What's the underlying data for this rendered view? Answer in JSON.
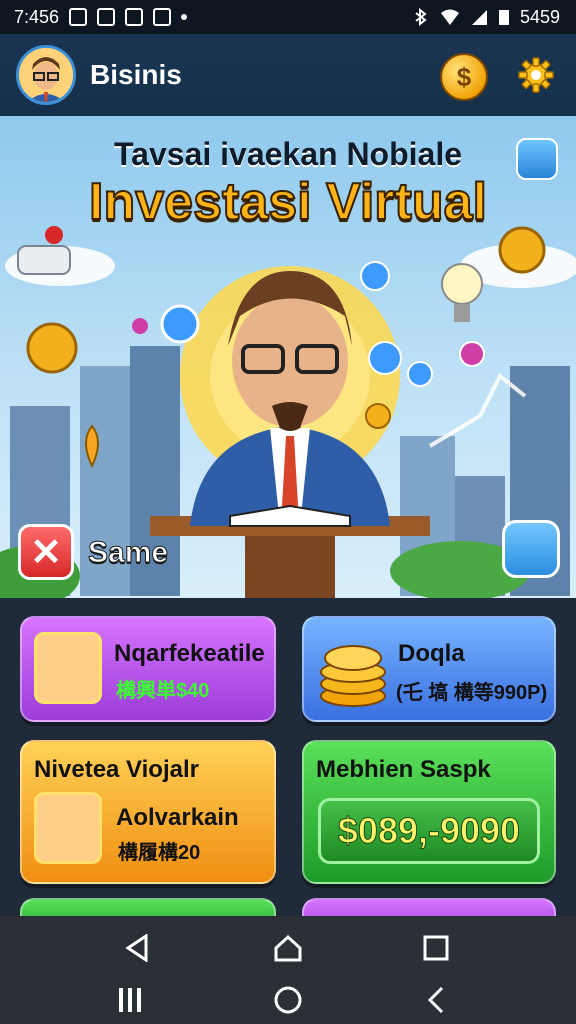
{
  "status_bar": {
    "time": "7:456",
    "right_text": "5459"
  },
  "header": {
    "title": "Bisinis"
  },
  "hero": {
    "subtitle": "Tavsai ivaekan Nobiale",
    "title": "Investasi Virtual",
    "label": "Same",
    "coin_symbol": "$"
  },
  "cards": [
    {
      "title": "Nqarfekeatile",
      "subtitle": "構興単$40",
      "subtitle_color": "#3bff2f"
    },
    {
      "title": "Doqla",
      "subtitle": "(乇 塙 構等990P)",
      "subtitle_color": "#111111"
    },
    {
      "title": "Nivetea Viojalr",
      "name": "Aolvarkain",
      "subtitle": "構履構20",
      "subtitle_color": "#111111"
    },
    {
      "title": "Mebhien Saspk",
      "amount": "$089,-9090"
    }
  ],
  "icons": {
    "header": [
      "avatar",
      "coin-icon",
      "gear-icon"
    ],
    "nav": [
      "back-icon",
      "home-icon",
      "recents-icon",
      "menu-icon",
      "circle-home-icon",
      "chevron-back-icon"
    ]
  },
  "colors": {
    "accent_gold": "#ffb416",
    "header_bg": "#1a3552",
    "nav_bg": "#2b2f36"
  }
}
